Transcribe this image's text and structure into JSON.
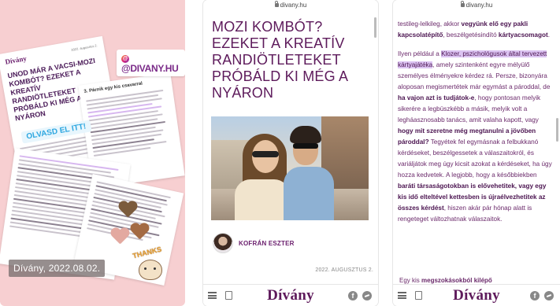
{
  "story": {
    "card_logo": "Dívány",
    "card_date": "2022. augusztus 2.",
    "card_headline": "UNOD MÁR A VACSI-MOZI KOMBÓT? EZEKET A KREATÍV RANDIÖTLETEKET PRÓBÁLD KI MÉG A NYÁRON",
    "card_subhead": "3. Párnik egy kis csavarral",
    "mention_tag": "@DIVANY.HU",
    "read_tag": "OLVASD EL ITT!",
    "thanks_sticker": "THANKS",
    "date_label": "Dívány, 2022.08.02."
  },
  "browser": {
    "url": "divany.hu",
    "brand": "Dívány",
    "facebook_glyph": "f"
  },
  "article": {
    "title": "MOZI KOMBÓT? EZEKET A KREATÍV RANDIÖTLETEKET PRÓBÁLD KI MÉG A NYÁRON",
    "author": "KOFRÁN ESZTER",
    "date": "2022. AUGUSZTUS 2."
  },
  "article_body": {
    "p1_a": "testileg-lelkileg, akkor ",
    "p1_b": "vegyünk elő egy pakli kapcsolatépítő",
    "p1_c": ", beszélgetésindító ",
    "p1_d": "kártyacsomagot",
    "p1_e": ".",
    "p2_a": "Ilyen például a ",
    "p2_hl": "Klozer, pszichológusok által tervezett kártyajátéka",
    "p2_b": ", amely szintenként egyre mélyülő személyes élményekre kérdez rá. Persze, bizonyára aloposan megismertétek már egymást a pároddal, de ",
    "p2_c": "ha vajon azt is tudjátok-e",
    "p2_d": ", hogy pontosan melyik sikerére a legbüszkébb a másik, melyik volt a legháasznosabb tanács, amit valaha kapott, vagy ",
    "p2_e": "hogy mit szeretne még megtanulni a jövőben pároddal?",
    "p2_f": " Tegyétek fel egymásnak a felbukkanó kérdéseket, beszélgessetek a válaszaitokról, és variáljátok meg úgy kicsit azokat a kérdéseket, ha úgy hozza kedvetek. A legjobb, hogy a későbbiekben ",
    "p2_g": "baráti társaságotokban is elővehetitek, vagy egy kis idő elteltével kettesben is újraélvezhetitek az összes kérdést",
    "p2_h": ", hiszen akár pár hónap alatt is rengeteget változhatnak válaszaitok.",
    "p3_a": "Egy kis ",
    "p3_hl": "megszokásokból kilépő"
  }
}
